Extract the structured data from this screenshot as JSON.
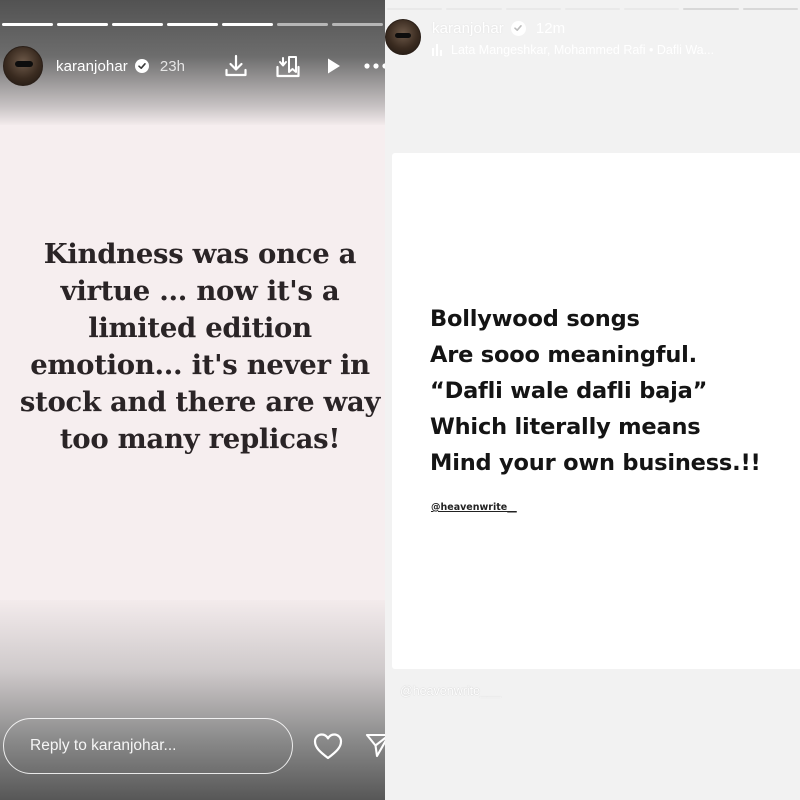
{
  "left_story": {
    "header": {
      "username": "karanjohar",
      "timestamp": "23h"
    },
    "icons": [
      "download-icon",
      "save-icon",
      "play-icon",
      "more-icon"
    ],
    "quote_lines": [
      "Kindness was once a",
      "virtue ... now it's a",
      "limited edition",
      "emotion... it's never in",
      "stock and there are way",
      "too many replicas!"
    ],
    "reply": {
      "placeholder": "Reply to karanjohar..."
    }
  },
  "right_story": {
    "header": {
      "username": "karanjohar",
      "timestamp": "12m",
      "music": "Lata Mangeshkar,  Mohammed Rafi • Dafli Wa..."
    },
    "text_lines": [
      "Bollywood songs",
      "Are sooo meaningful.",
      "“Dafli wale dafli baja”",
      "Which literally means",
      "Mind your own business.!!"
    ],
    "handle": "@heavenwrite__",
    "watermark": "@heavenwrite___"
  },
  "colors": {
    "left_bg": "#f6eeef",
    "left_text": "#2a2426",
    "right_bg": "#f2f2f2",
    "card": "#ffffff",
    "right_text": "#141414"
  }
}
